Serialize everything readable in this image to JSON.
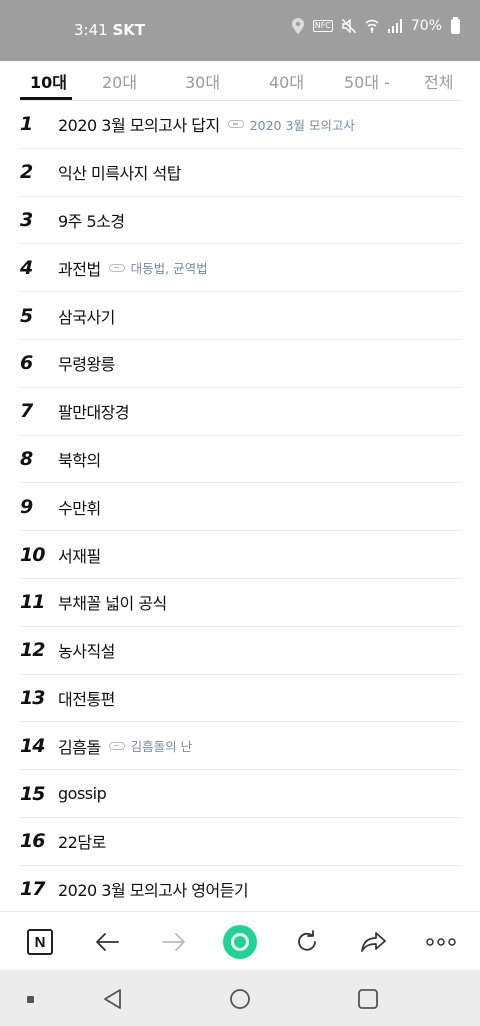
{
  "status_bar": {
    "time": "3:41",
    "carrier": "SKT",
    "nfc": "NFC",
    "battery": "70%",
    "icons": [
      "location-icon",
      "nfc-icon",
      "mute-icon",
      "wifi-icon",
      "signal-icon",
      "battery-icon"
    ]
  },
  "tabs": [
    {
      "label": "10대",
      "active": true
    },
    {
      "label": "20대"
    },
    {
      "label": "30대"
    },
    {
      "label": "40대"
    },
    {
      "label": "50대 -"
    },
    {
      "label": "전체"
    }
  ],
  "rankings": [
    {
      "rank": "1",
      "keyword": "2020 3월 모의고사 답지",
      "related": "2020 3월 모의고사"
    },
    {
      "rank": "2",
      "keyword": "익산 미륵사지 석탑"
    },
    {
      "rank": "3",
      "keyword": "9주 5소경"
    },
    {
      "rank": "4",
      "keyword": "과전법",
      "related": "대동법, 균역법"
    },
    {
      "rank": "5",
      "keyword": "삼국사기"
    },
    {
      "rank": "6",
      "keyword": "무령왕릉"
    },
    {
      "rank": "7",
      "keyword": "팔만대장경"
    },
    {
      "rank": "8",
      "keyword": "북학의"
    },
    {
      "rank": "9",
      "keyword": "수만휘"
    },
    {
      "rank": "10",
      "keyword": "서재필"
    },
    {
      "rank": "11",
      "keyword": "부채꼴 넓이 공식"
    },
    {
      "rank": "12",
      "keyword": "농사직설"
    },
    {
      "rank": "13",
      "keyword": "대전통편"
    },
    {
      "rank": "14",
      "keyword": "김흠돌",
      "related": "김흠돌의 난"
    },
    {
      "rank": "15",
      "keyword": "gossip"
    },
    {
      "rank": "16",
      "keyword": "22담로"
    },
    {
      "rank": "17",
      "keyword": "2020 3월 모의고사 영어듣기"
    }
  ],
  "toolbar": {
    "naver_label": "N",
    "icons": [
      "naver-home-icon",
      "back-arrow-icon",
      "forward-arrow-icon",
      "green-dot-icon",
      "refresh-icon",
      "share-icon",
      "more-icon"
    ],
    "accent": "#1fd394"
  },
  "nav_bar": {
    "icons": [
      "recent-dot-icon",
      "nav-back-icon",
      "nav-home-icon",
      "nav-recents-icon"
    ]
  }
}
